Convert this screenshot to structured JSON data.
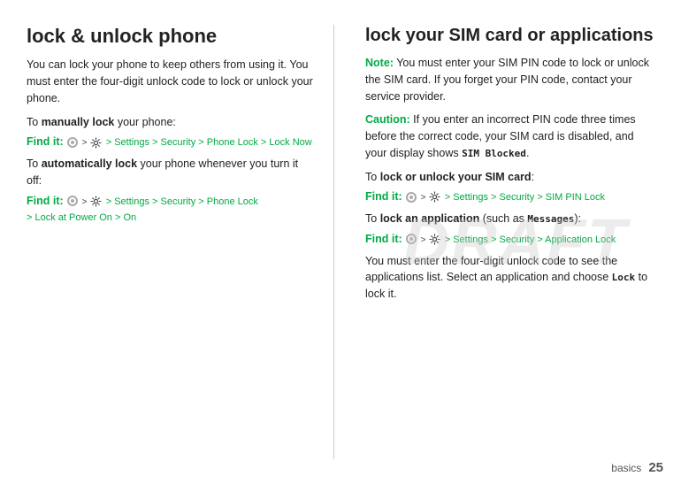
{
  "left": {
    "title": "lock & unlock phone",
    "para1": "You can lock your phone to keep others from using it. You must enter the four-digit unlock code to lock or unlock your phone.",
    "to_manually": "To ",
    "manually_bold": "manually lock",
    "to_manually_rest": " your phone:",
    "find_it_label": "Find it:",
    "find_it_1": " > Settings > Security > Phone Lock > Lock Now",
    "to_auto": "To ",
    "auto_bold": "automatically lock",
    "to_auto_rest": " your phone whenever you turn it off:",
    "find_it_2": " > Settings > Security > Phone Lock",
    "find_it_2b": " > Lock at Power On > On"
  },
  "right": {
    "title": "lock your SIM card or applications",
    "note_label": "Note:",
    "note_text": " You must enter your SIM PIN code to lock or unlock the SIM card. If you forget your PIN code, contact your service provider.",
    "caution_label": "Caution:",
    "caution_text": " If you enter an incorrect PIN code three times before the correct code, your SIM card is disabled, and your display shows ",
    "sim_blocked": "SIM Blocked",
    "caution_end": ".",
    "to_lock_sim": "To ",
    "lock_sim_bold": "lock or unlock your SIM card",
    "to_lock_sim_end": ":",
    "find_it_sim": " > Settings > Security > SIM PIN Lock",
    "to_lock_app": "To ",
    "lock_app_bold": "lock an application",
    "lock_app_mid": " (such as ",
    "lock_app_messages": "Messages",
    "lock_app_end": "):",
    "find_it_app": " > Settings > Security > Application Lock",
    "para_final": "You must enter the four-digit unlock code to see the applications list. Select an application and choose ",
    "lock_word": "Lock",
    "para_final_end": " to lock it."
  },
  "footer": {
    "text": "basics",
    "number": "25"
  }
}
